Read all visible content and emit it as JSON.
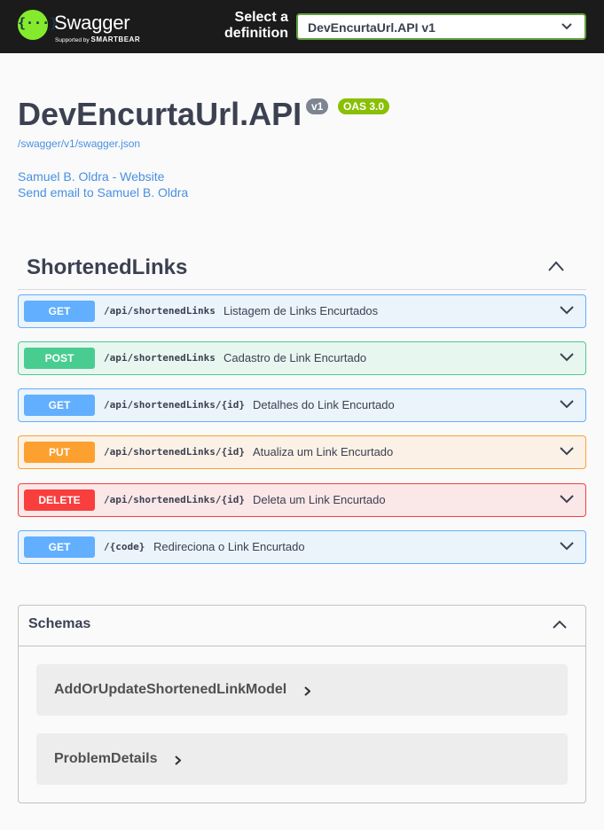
{
  "topbar": {
    "logo_text": "Swagger",
    "logo_sub": "Supported by",
    "logo_sub_brand": "SMARTBEAR",
    "select_label_line1": "Select a",
    "select_label_line2": "definition",
    "select_value": "DevEncurtaUrl.API v1"
  },
  "info": {
    "title": "DevEncurtaUrl.API",
    "version": "v1",
    "oas": "OAS 3.0",
    "spec_url": "/swagger/v1/swagger.json",
    "contact_website": "Samuel B. Oldra - Website",
    "contact_email": "Send email to Samuel B. Oldra"
  },
  "tag": {
    "name": "ShortenedLinks"
  },
  "operations": [
    {
      "method": "GET",
      "path": "/api/shortenedLinks",
      "summary": "Listagem de Links Encurtados"
    },
    {
      "method": "POST",
      "path": "/api/shortenedLinks",
      "summary": "Cadastro de Link Encurtado"
    },
    {
      "method": "GET",
      "path": "/api/shortenedLinks/{id}",
      "summary": "Detalhes do Link Encurtado"
    },
    {
      "method": "PUT",
      "path": "/api/shortenedLinks/{id}",
      "summary": "Atualiza um Link Encurtado"
    },
    {
      "method": "DELETE",
      "path": "/api/shortenedLinks/{id}",
      "summary": "Deleta um Link Encurtado"
    },
    {
      "method": "GET",
      "path": "/{code}",
      "summary": "Redireciona o Link Encurtado"
    }
  ],
  "method_colors": {
    "GET": {
      "accent": "#61affe",
      "bg": "#ebf3fb"
    },
    "POST": {
      "accent": "#49cc90",
      "bg": "#e8f6f0"
    },
    "PUT": {
      "accent": "#fca130",
      "bg": "#fbf1e6"
    },
    "DELETE": {
      "accent": "#f93e3e",
      "bg": "#fae7e7"
    }
  },
  "schemas": {
    "title": "Schemas",
    "models": [
      {
        "name": "AddOrUpdateShortenedLinkModel"
      },
      {
        "name": "ProblemDetails"
      }
    ]
  },
  "icons": {
    "logo": "swagger-logo-icon",
    "select_chevron": "chevron-down-icon",
    "tag_toggle": "chevron-up-icon",
    "op_toggle": "chevron-down-icon",
    "model_expand": "chevron-right-icon"
  }
}
